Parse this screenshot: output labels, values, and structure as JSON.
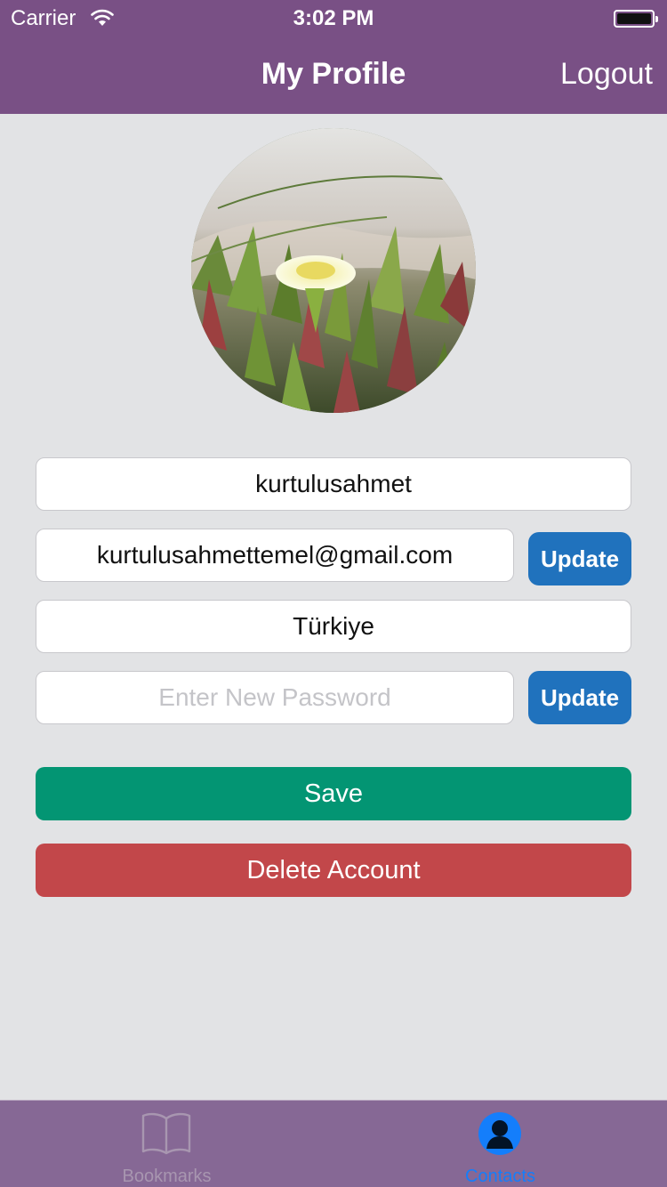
{
  "status_bar": {
    "carrier": "Carrier",
    "time": "3:02 PM"
  },
  "nav": {
    "title": "My Profile",
    "logout_label": "Logout"
  },
  "profile": {
    "avatar_icon": "profile-photo-flower",
    "username": "kurtulusahmet",
    "email": "kurtulusahmettemel@gmail.com",
    "email_update_label": "Update",
    "country": "Türkiye",
    "password_value": "",
    "password_placeholder": "Enter New Password",
    "password_update_label": "Update",
    "save_label": "Save",
    "delete_label": "Delete Account"
  },
  "tab_bar": {
    "tabs": [
      {
        "label": "Bookmarks",
        "icon": "book-icon",
        "active": false
      },
      {
        "label": "Contacts",
        "icon": "contact-icon",
        "active": true
      }
    ]
  },
  "colors": {
    "nav_bg": "#795085",
    "page_bg": "#e2e3e5",
    "update_blue": "#2072bd",
    "save_green": "#039573",
    "delete_red": "#c2474a",
    "tab_bg": "#866895",
    "tab_active": "#147efb",
    "tab_inactive": "#a896b0"
  }
}
